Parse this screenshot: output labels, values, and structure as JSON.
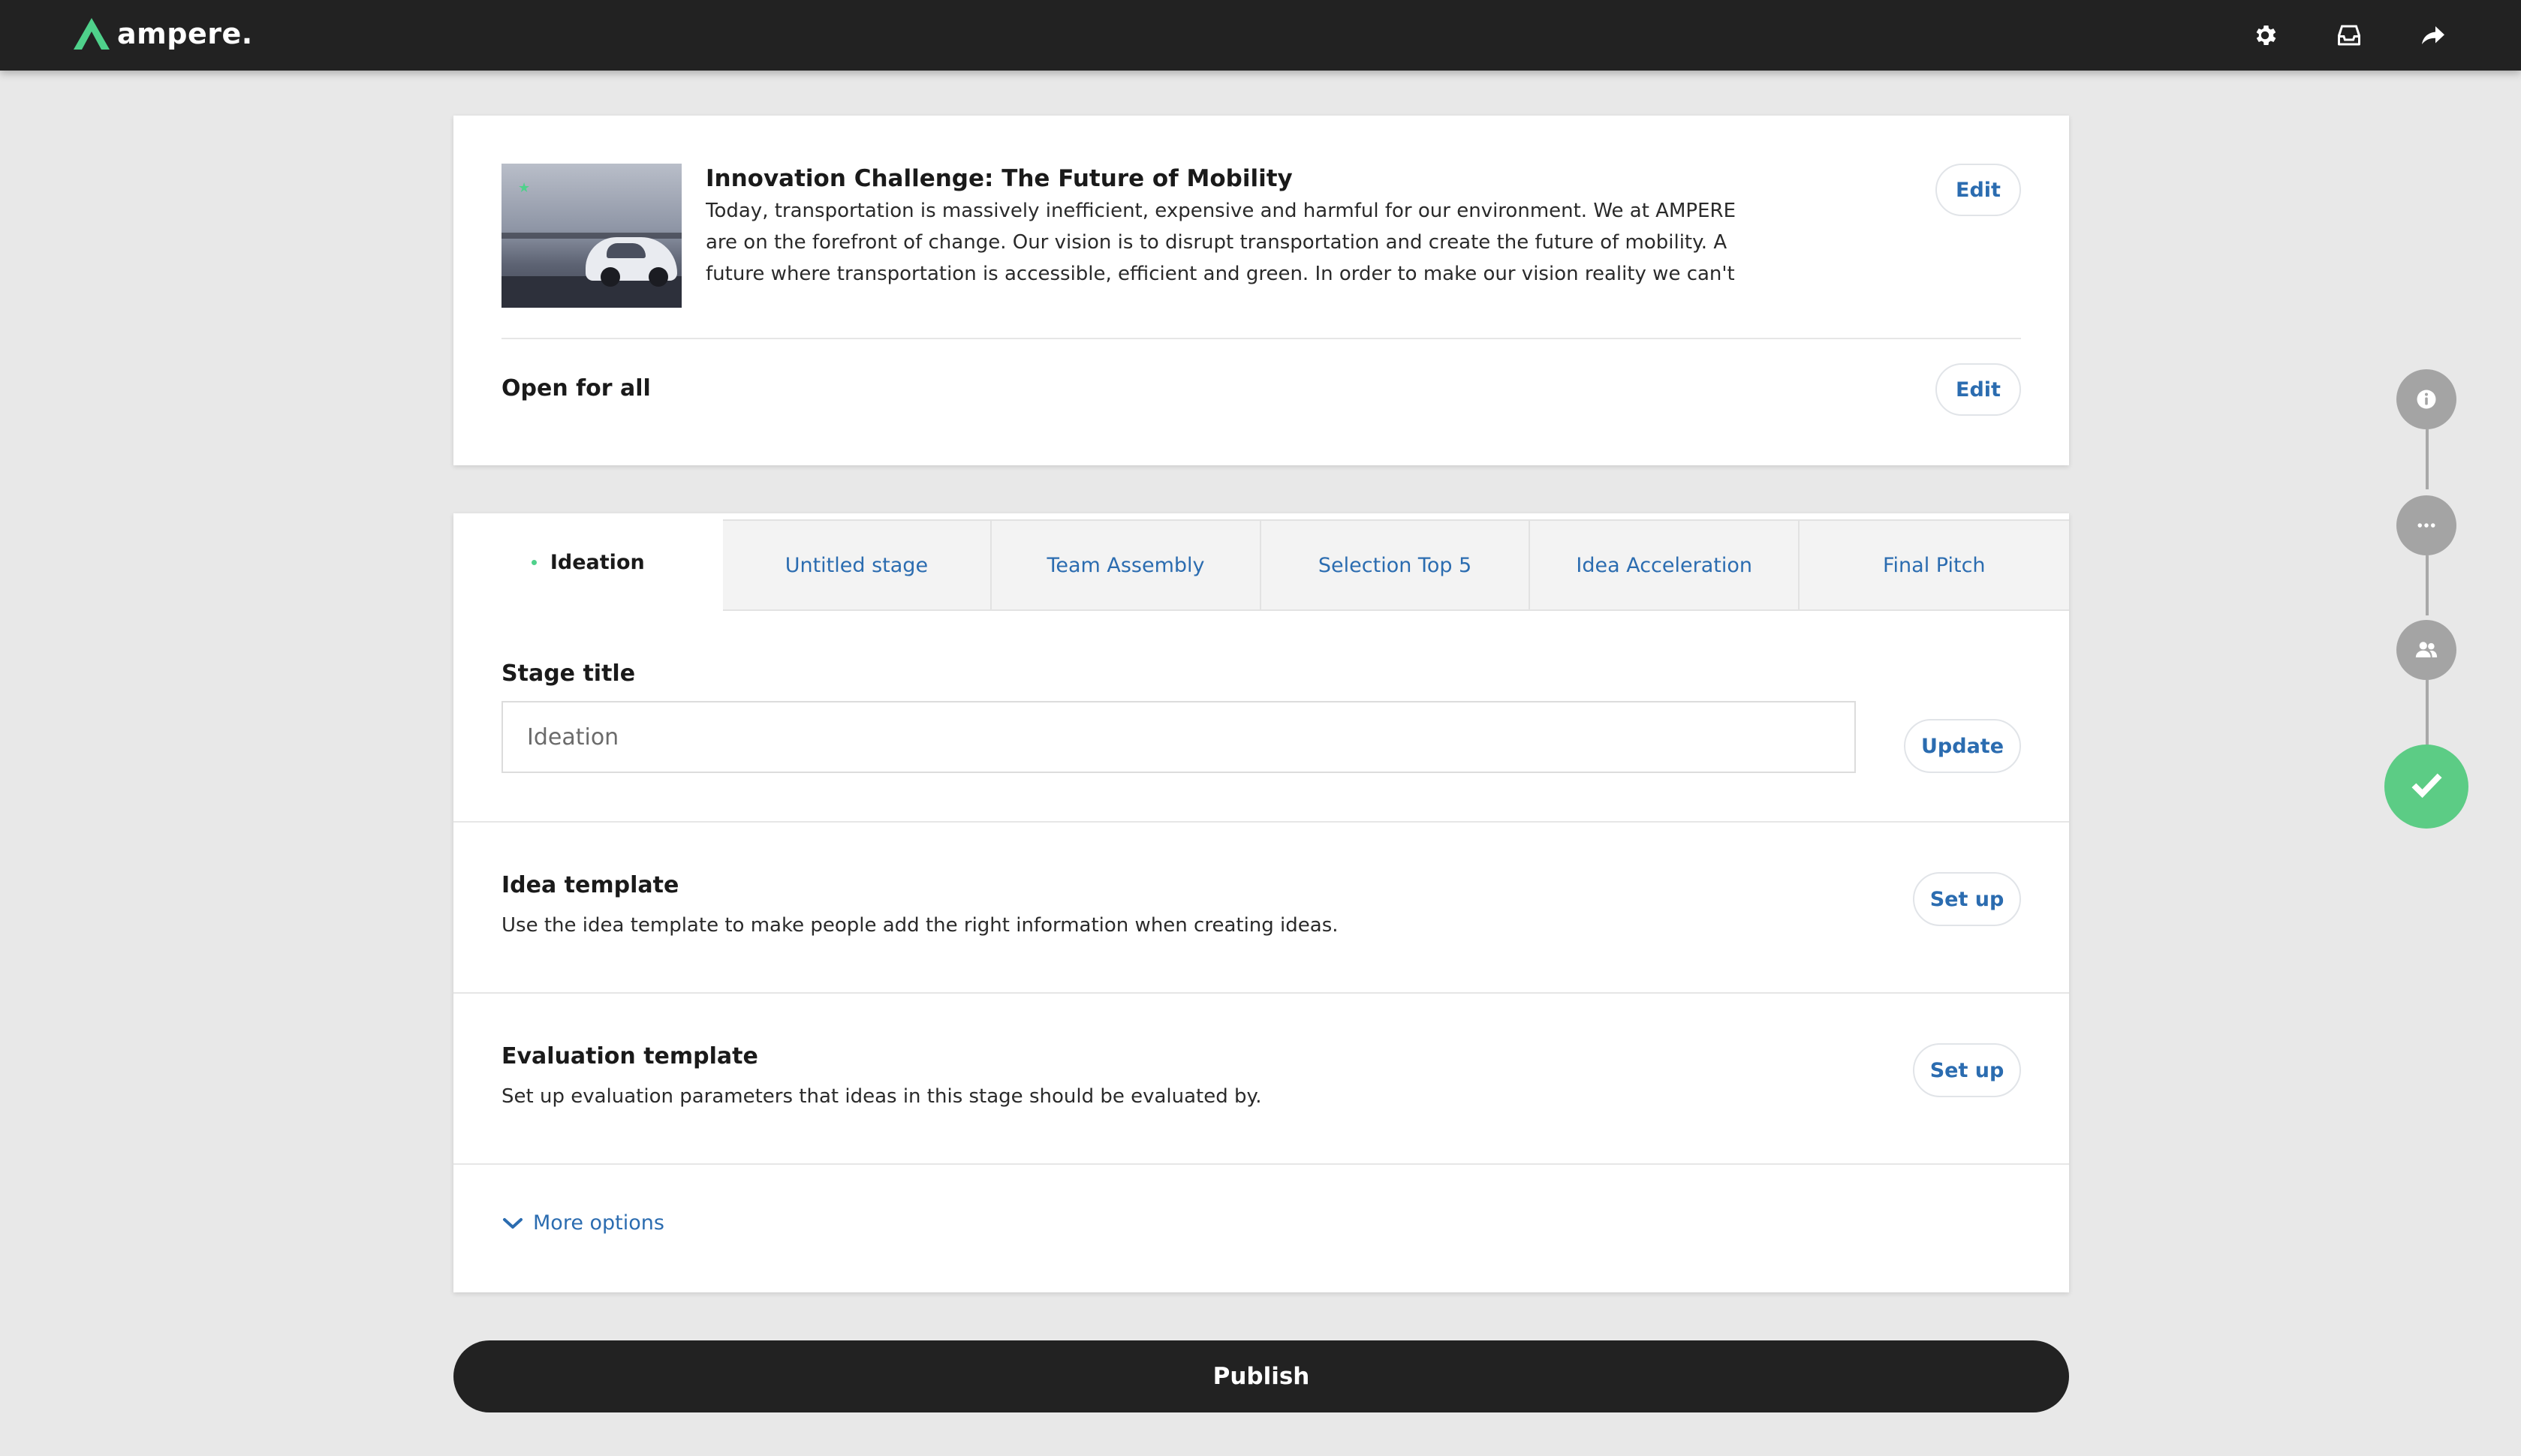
{
  "app": {
    "logo_text": "ampere.",
    "brand_color": "#4fd18b",
    "top_icons": [
      "gear-icon",
      "inbox-icon",
      "share-icon"
    ]
  },
  "challenge": {
    "title": "Innovation Challenge: The Future of Mobility",
    "description": "Today, transportation is massively inefficient, expensive and harmful for our environment. We at AMPERE are on the forefront of change. Our vision is to disrupt transportation and create the future of mobility. A future where transportation is accessible, efficient and green. In order to make our vision reality we can't stand still,",
    "edit_label": "Edit",
    "access_label": "Open for all",
    "access_edit_label": "Edit"
  },
  "stages": {
    "tabs": [
      {
        "label": "Ideation",
        "active": true
      },
      {
        "label": "Untitled stage"
      },
      {
        "label": "Team Assembly"
      },
      {
        "label": "Selection Top 5"
      },
      {
        "label": "Idea Acceleration"
      },
      {
        "label": "Final Pitch"
      }
    ],
    "stage_title": {
      "label": "Stage title",
      "value": "Ideation",
      "update_label": "Update"
    },
    "idea_template": {
      "title": "Idea template",
      "description": "Use the idea template to make people add the right information when creating ideas.",
      "button_label": "Set up"
    },
    "evaluation_template": {
      "title": "Evaluation template",
      "description": "Set up evaluation parameters that ideas in this stage should be evaluated by.",
      "button_label": "Set up"
    },
    "more_options_label": "More options"
  },
  "publish_label": "Publish",
  "progress_steps": [
    "info-icon",
    "ellipsis-icon",
    "users-icon",
    "check-icon"
  ],
  "colors": {
    "link": "#2b6cb0",
    "dark": "#222222",
    "success": "#5ccc85"
  }
}
